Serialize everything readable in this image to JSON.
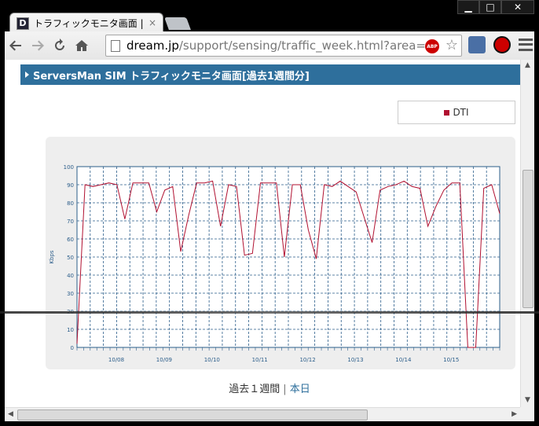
{
  "browser": {
    "tab_title": "トラフィックモニタ画面 |",
    "tab_close": "×",
    "url_host": "dream.jp",
    "url_path": "/support/sensing/traffic_week.html?area=r",
    "abp_label": "ABP",
    "window_controls": {
      "minimize": "▁",
      "maximize": "□",
      "close": "✕"
    }
  },
  "page": {
    "header_title": "ServersMan SIM トラフィックモニタ画面[過去1週間分]",
    "legend_label": "DTI",
    "footer": {
      "past_week": "過去１週間",
      "separator": "|",
      "today": "本日"
    }
  },
  "chart_data": {
    "type": "line",
    "ylabel": "Kbps",
    "ylim": [
      0,
      100
    ],
    "y_ticks": [
      "0",
      "10",
      "20",
      "30",
      "40",
      "50",
      "60",
      "70",
      "80",
      "90",
      "100"
    ],
    "x_tick_labels": [
      "10/08",
      "10/09",
      "10/10",
      "10/11",
      "10/12",
      "10/13",
      "10/14",
      "10/15"
    ],
    "grid": true,
    "legend_position": "top-right",
    "series": [
      {
        "name": "DTI",
        "color": "#b01030",
        "values": [
          2,
          90,
          89,
          90,
          91,
          90,
          71,
          91,
          91,
          91,
          75,
          87,
          89,
          53,
          73,
          91,
          91,
          92,
          67,
          90,
          89,
          51,
          52,
          91,
          91,
          91,
          50,
          90,
          90,
          65,
          49,
          90,
          89,
          92,
          89,
          86,
          72,
          58,
          87,
          89,
          90,
          92,
          89,
          88,
          67,
          78,
          87,
          91,
          91,
          0,
          0,
          88,
          90,
          74
        ]
      }
    ]
  }
}
